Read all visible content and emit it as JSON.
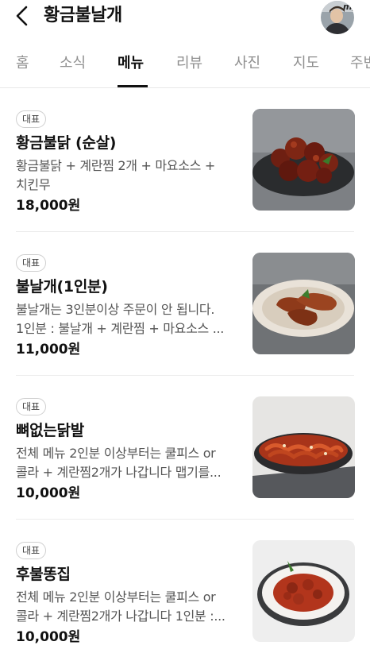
{
  "header": {
    "title": "황금불날개",
    "avatar_text": "my"
  },
  "tabs": [
    {
      "label": "홈",
      "active": false
    },
    {
      "label": "소식",
      "active": false
    },
    {
      "label": "메뉴",
      "active": true
    },
    {
      "label": "리뷰",
      "active": false
    },
    {
      "label": "사진",
      "active": false
    },
    {
      "label": "지도",
      "active": false
    },
    {
      "label": "주변",
      "active": false
    }
  ],
  "menu": [
    {
      "badge": "대표",
      "name": "황금불닭 (순살)",
      "desc_line1": "황금불닭 + 계란찜 2개 + 마요소스 +",
      "desc_line2": "치킨무",
      "price": "18,000원"
    },
    {
      "badge": "대표",
      "name": "불날개(1인분)",
      "desc_line1": "불날개는 3인분이상 주문이 안 됩니다.",
      "desc_line2": "1인분 : 불날개 + 계란찜 + 마요소스 ...",
      "price": "11,000원"
    },
    {
      "badge": "대표",
      "name": "뼈없는닭발",
      "desc_line1": "전체 메뉴 2인분 이상부터는 쿨피스 or",
      "desc_line2": "콜라 + 계란찜2개가 나갑니다 맵기를...",
      "price": "10,000원"
    },
    {
      "badge": "대표",
      "name": "후불똥집",
      "desc_line1": "전체 메뉴 2인분 이상부터는 쿨피스 or",
      "desc_line2": "콜라 + 계란찜2개가 나갑니다 1인분 :...",
      "price": "10,000원"
    }
  ]
}
